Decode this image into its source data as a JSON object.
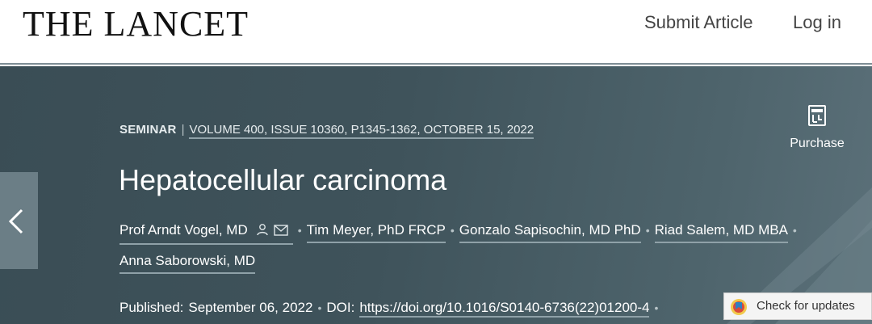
{
  "header": {
    "logo": "THE LANCET",
    "nav": {
      "submit": "Submit Article",
      "login": "Log in"
    }
  },
  "article": {
    "type": "SEMINAR",
    "separator": "|",
    "volume_info": "VOLUME 400, ISSUE 10360, P1345-1362, OCTOBER 15, 2022",
    "title": "Hepatocellular carcinoma",
    "authors": [
      "Prof Arndt Vogel, MD",
      "Tim Meyer, PhD FRCP",
      "Gonzalo Sapisochin, MD PhD",
      "Riad Salem, MD MBA",
      "Anna Saborowski, MD"
    ],
    "published_label": "Published:",
    "published_date": "September 06, 2022",
    "doi_label": "DOI:",
    "doi": "https://doi.org/10.1016/S0140-6736(22)01200-4"
  },
  "sidebar": {
    "purchase_label": "Purchase",
    "purchase_icon": "pdf-icon"
  },
  "widgets": {
    "check_updates": "Check for updates",
    "back_icon": "chevron-left-icon",
    "dot": "•"
  },
  "colors": {
    "hero_bg": "#3f535b",
    "underline": "#8fa1a8",
    "rule": "#7d8d94"
  }
}
